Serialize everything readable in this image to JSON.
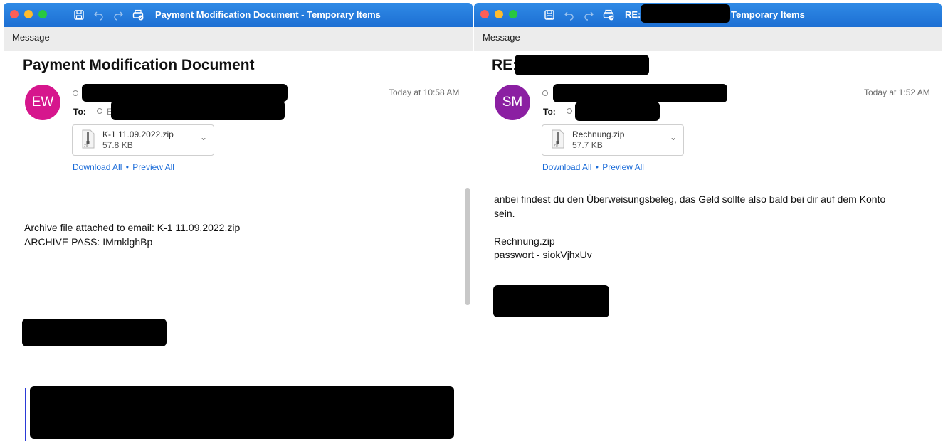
{
  "left": {
    "title": "Payment Modification Document - Temporary Items",
    "toolbar_tab": "Message",
    "subject": "Payment Modification Document",
    "avatar": "EW",
    "avatar_color": "#d6168d",
    "sender_fragment": "E",
    "to_label": "To:",
    "date": "Today at 10:58 AM",
    "attachment": {
      "name": "K-1 11.09.2022.zip",
      "size": "57.8 KB"
    },
    "download_all": "Download All",
    "separator": "•",
    "preview_all": "Preview All",
    "body_line1": "Archive file attached to email: K-1 11.09.2022.zip",
    "body_line2": "ARCHIVE PASS: IMmklghBp"
  },
  "right": {
    "title_prefix": "RE:",
    "title_suffix": "Temporary Items",
    "toolbar_tab": "Message",
    "subject": "RE:",
    "avatar": "SM",
    "avatar_color": "#8b1fa2",
    "to_label": "To:",
    "date": "Today at 1:52 AM",
    "attachment": {
      "name": "Rechnung.zip",
      "size": "57.7 KB"
    },
    "download_all": "Download All",
    "separator": "•",
    "preview_all": "Preview All",
    "body_line1": "anbei findest du den Überweisungsbeleg, das Geld sollte also bald bei dir auf dem Konto",
    "body_line2": "sein.",
    "body_line3": "Rechnung.zip",
    "body_line4": "passwort - siokVjhxUv"
  },
  "icons": [
    "save-icon",
    "undo-icon",
    "redo-icon",
    "print-icon",
    "zip-file-icon",
    "chevron-down-icon"
  ]
}
